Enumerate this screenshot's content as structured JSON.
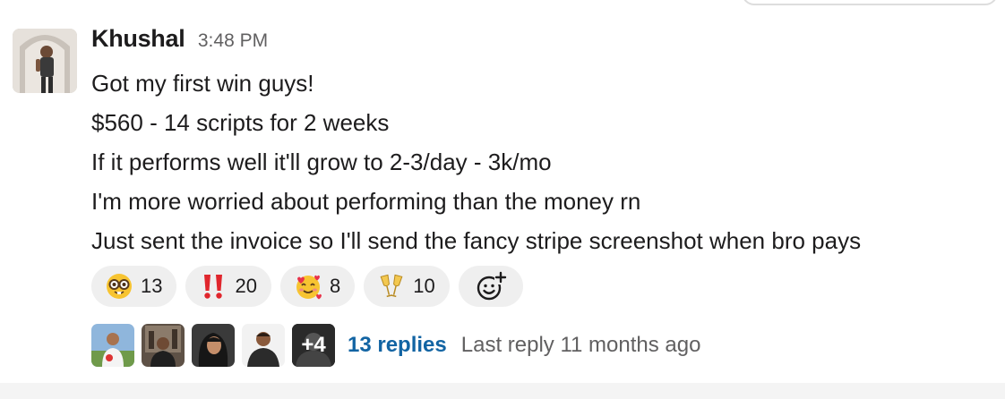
{
  "message": {
    "sender": "Khushal",
    "timestamp": "3:48 PM",
    "lines": [
      "Got my first win guys!",
      "$560 - 14 scripts for 2 weeks",
      "If it performs well it'll grow to 2-3/day - 3k/mo",
      "I'm more worried about performing than the money rn",
      "Just sent the invoice so I'll send the fancy stripe screenshot when bro pays"
    ]
  },
  "reactions": [
    {
      "emoji": "nerd-face-icon",
      "count": "13"
    },
    {
      "emoji": "double-exclamation-icon",
      "count": "20"
    },
    {
      "emoji": "smiling-face-with-hearts-icon",
      "count": "8"
    },
    {
      "emoji": "clinking-glasses-icon",
      "count": "10"
    }
  ],
  "add_reaction": {
    "icon": "add-reaction-icon"
  },
  "thread": {
    "more_avatars": "+4",
    "reply_count": "13 replies",
    "last_reply": "Last reply 11 months ago"
  },
  "colors": {
    "link": "#1264a3",
    "muted": "#616061",
    "reaction_bg": "#efefef",
    "text": "#1d1c1d"
  }
}
